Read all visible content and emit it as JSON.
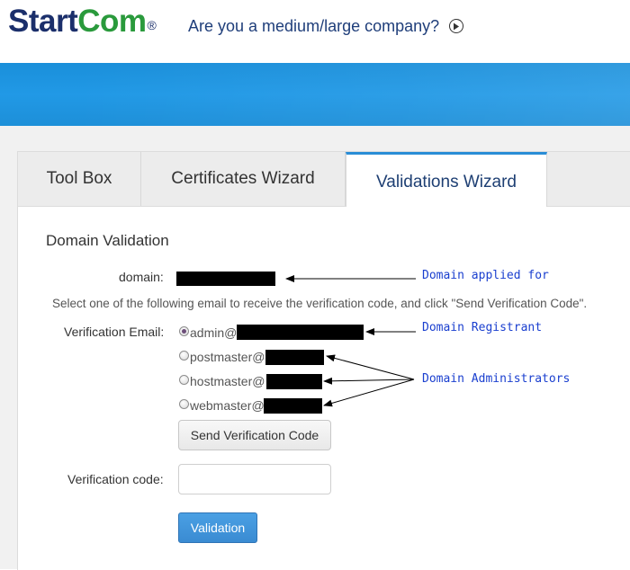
{
  "header": {
    "logo_start": "Start",
    "logo_com": "Com",
    "logo_reg": "®",
    "tagline": "Are you a medium/large company?",
    "tagline_icon": "arrow-circle-right-icon"
  },
  "tabs": [
    {
      "label": "Tool Box",
      "active": false
    },
    {
      "label": "Certificates Wizard",
      "active": false
    },
    {
      "label": "Validations Wizard",
      "active": true
    }
  ],
  "form": {
    "section_title": "Domain Validation",
    "domain_label": "domain:",
    "instructions": "Select one of the following email to receive the verification code, and click \"Send Verification Code\".",
    "email_label": "Verification Email:",
    "email_options": [
      {
        "prefix": "admin@",
        "checked": true
      },
      {
        "prefix": "postmaster@",
        "checked": false
      },
      {
        "prefix": "hostmaster@",
        "checked": false
      },
      {
        "prefix": "webmaster@",
        "checked": false
      }
    ],
    "send_button": "Send Verification Code",
    "code_label": "Verification code:",
    "code_value": "",
    "validate_button": "Validation"
  },
  "annotations": {
    "domain_applied": "Domain applied for",
    "registrant": "Domain Registrant",
    "administrators": "Domain Administrators"
  },
  "colors": {
    "brand_blue": "#1b2f6b",
    "brand_green": "#2a9a3c",
    "banner": "#1d93de",
    "primary_button": "#3a8bd2",
    "annotation": "#1a3fcf"
  }
}
